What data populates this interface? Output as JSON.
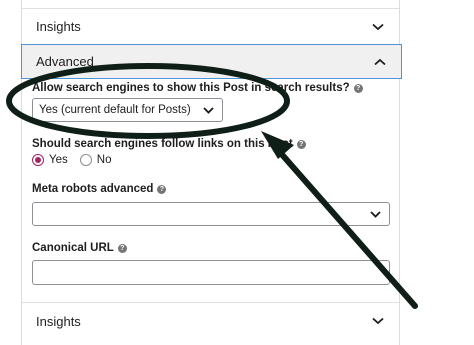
{
  "sections": {
    "insights_top": "Insights",
    "advanced": "Advanced",
    "insights_bottom": "Insights"
  },
  "fields": {
    "search_engines_show": {
      "label": "Allow search engines to show this Post in search results?",
      "value": "Yes (current default for Posts)"
    },
    "follow_links": {
      "label": "Should search engines follow links on this Post",
      "options": [
        "Yes",
        "No"
      ],
      "selected": "Yes"
    },
    "meta_robots": {
      "label": "Meta robots advanced",
      "value": ""
    },
    "canonical_url": {
      "label": "Canonical URL",
      "value": ""
    }
  },
  "colors": {
    "annotation": "#0f1f17",
    "focus_border": "#4f94d4",
    "radio_checked": "#a3245e"
  },
  "icons": {
    "help": "?"
  }
}
